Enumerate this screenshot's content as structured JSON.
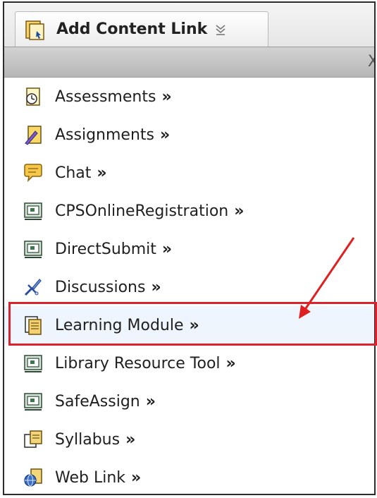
{
  "toolbar": {
    "add_button_label": "Add Content Link",
    "add_button_icon": "page-icon",
    "dropdown_icon": "chevron-down-icon"
  },
  "panel": {
    "close_label": "X",
    "items": [
      {
        "label": "Assessments",
        "arrow": "»",
        "icon": "assessment-icon"
      },
      {
        "label": "Assignments",
        "arrow": "»",
        "icon": "assignment-icon"
      },
      {
        "label": "Chat",
        "arrow": "»",
        "icon": "chat-icon"
      },
      {
        "label": "CPSOnlineRegistration",
        "arrow": "»",
        "icon": "tool-icon"
      },
      {
        "label": "DirectSubmit",
        "arrow": "»",
        "icon": "tool-icon"
      },
      {
        "label": "Discussions",
        "arrow": "»",
        "icon": "discussion-icon"
      },
      {
        "label": "Learning Module",
        "arrow": "»",
        "icon": "learning-module-icon"
      },
      {
        "label": "Library Resource Tool",
        "arrow": "»",
        "icon": "tool-icon"
      },
      {
        "label": "SafeAssign",
        "arrow": "»",
        "icon": "tool-icon"
      },
      {
        "label": "Syllabus",
        "arrow": "»",
        "icon": "syllabus-icon"
      },
      {
        "label": "Web Link",
        "arrow": "»",
        "icon": "web-link-icon"
      }
    ]
  },
  "colors": {
    "highlight_border": "#d9232e",
    "annotation_arrow": "#e02020"
  }
}
